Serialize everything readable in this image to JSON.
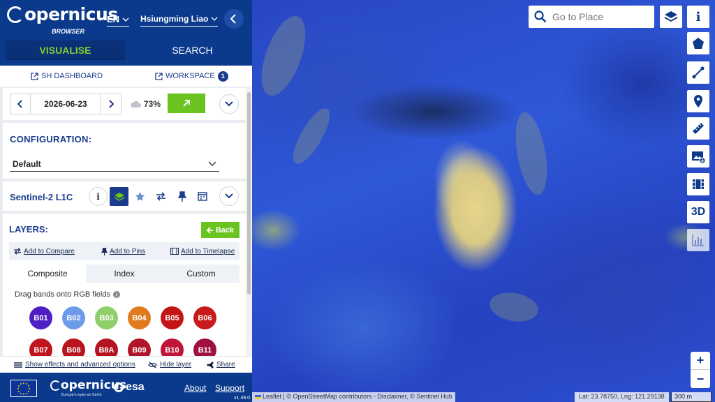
{
  "app": {
    "logo_text": "opernicus",
    "logo_sub": "BROWSER",
    "language": "EN",
    "user_name": "Hsiungming Liao",
    "tabs": {
      "visualise": "VISUALISE",
      "search": "SEARCH"
    }
  },
  "links": {
    "sh_dashboard": "SH DASHBOARD",
    "workspace": "WORKSPACE",
    "workspace_count": "1"
  },
  "date_panel": {
    "date": "2026-06-23",
    "cloud_coverage": "73%"
  },
  "configuration": {
    "title": "CONFIGURATION:",
    "selected": "Default"
  },
  "dataset": {
    "name": "Sentinel-2 L1C"
  },
  "layers": {
    "title": "LAYERS:",
    "back_label": "Back",
    "add_compare": "Add to Compare",
    "add_pins": "Add to Pins",
    "add_timelapse": "Add to Timelapse",
    "mode_tabs": [
      "Composite",
      "Index",
      "Custom"
    ],
    "drag_label": "Drag bands onto RGB fields",
    "bands": [
      {
        "label": "B01",
        "color": "#4e1fc4"
      },
      {
        "label": "B02",
        "color": "#6d9bea"
      },
      {
        "label": "B03",
        "color": "#8fce6a"
      },
      {
        "label": "B04",
        "color": "#e07a1f"
      },
      {
        "label": "B05",
        "color": "#c41414"
      },
      {
        "label": "B06",
        "color": "#c71a1a"
      },
      {
        "label": "B07",
        "color": "#c0141e"
      },
      {
        "label": "B08",
        "color": "#b8141e"
      },
      {
        "label": "B8A",
        "color": "#b51420"
      },
      {
        "label": "B09",
        "color": "#b01428"
      },
      {
        "label": "B10",
        "color": "#c01438"
      },
      {
        "label": "B11",
        "color": "#a01042"
      }
    ]
  },
  "bottom_bar": {
    "effects": "Show effects and advanced options",
    "hide_layer": "Hide layer",
    "share": "Share"
  },
  "footer": {
    "copernicus": "opernicus",
    "copernicus_sub": "Europe's eyes on Earth",
    "esa": "esa",
    "about": "About",
    "support": "Support",
    "version": "v1.49.0"
  },
  "map": {
    "search_placeholder": "Go to Place",
    "attribution": "Leaflet | © OpenStreetMap contributors - Disclaimer, © Sentinel Hub",
    "coords": "Lat: 23.78750, Lng: 121.29138",
    "scale": "300 m",
    "tool_3d": "3D",
    "zoom_in": "+",
    "zoom_out": "−"
  },
  "colors": {
    "brand_blue": "#0b3a8c",
    "accent_green": "#6ac31e",
    "active_tab_text": "#7cd12e"
  }
}
